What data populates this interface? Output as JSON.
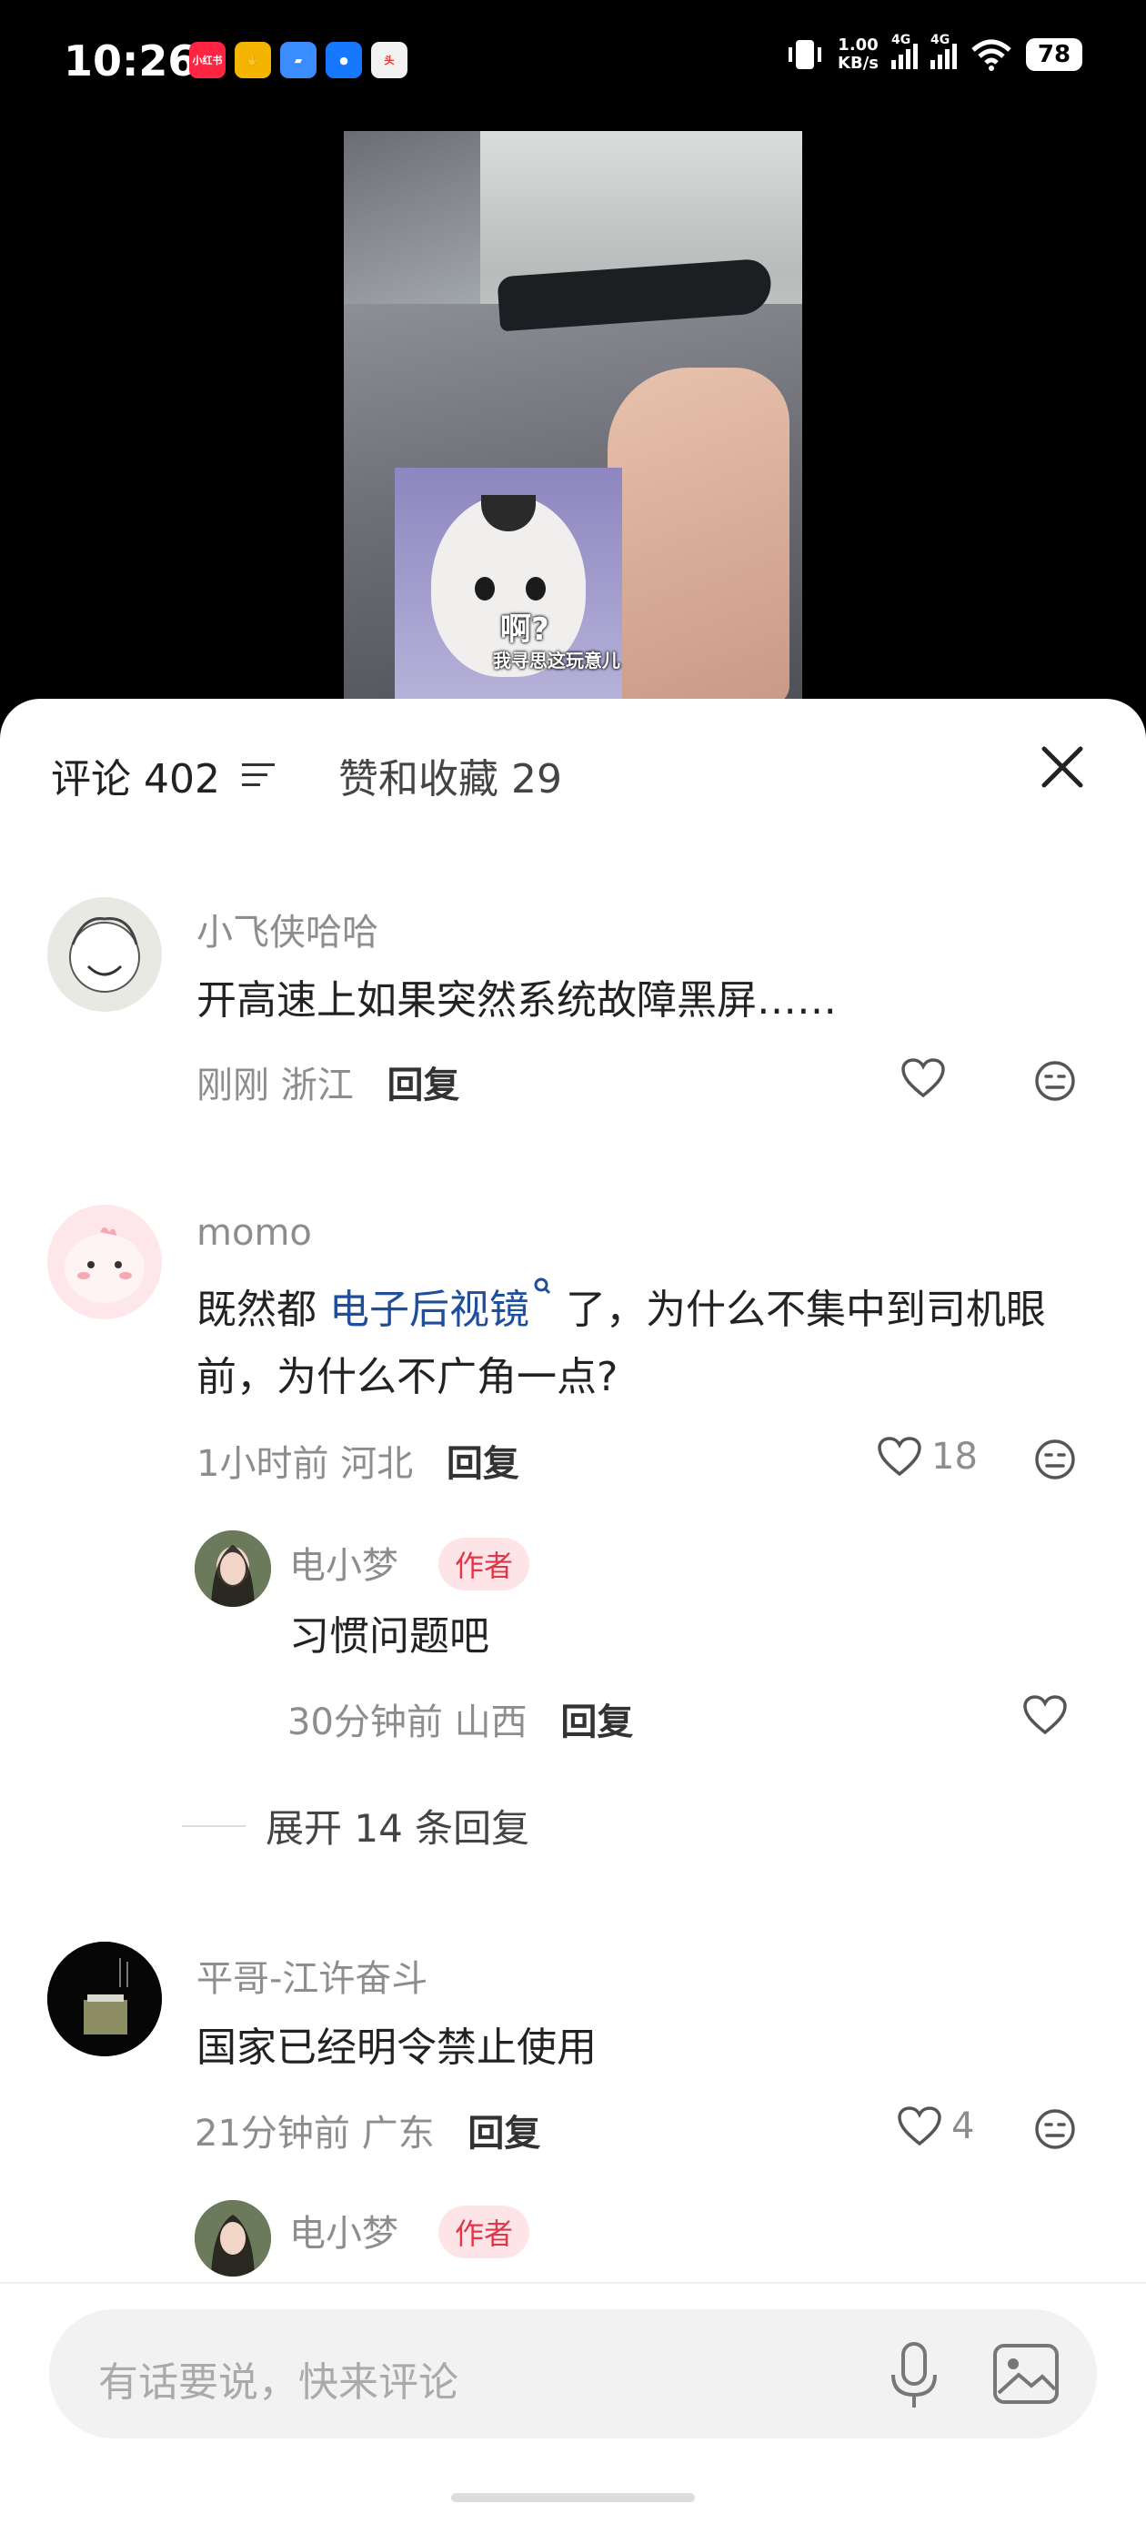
{
  "status_bar": {
    "time": "10:26",
    "network_speed_value": "1.00",
    "network_speed_unit": "KB/s",
    "signal_1_label": "4G",
    "signal_2_label": "4G",
    "battery": "78",
    "notification_icons": [
      "xiaohongshu-icon",
      "hand-app-icon",
      "files-app-icon",
      "message-app-icon",
      "toutiao-app-icon"
    ]
  },
  "video": {
    "subtitle_main": "啊?",
    "subtitle_sub": "我寻思这玩意儿"
  },
  "sheet": {
    "tab_comments": "评论 402",
    "tab_likes": "赞和收藏 29"
  },
  "comments": [
    {
      "username": "小飞侠哈哈",
      "text": "开高速上如果突然系统故障黑屏……",
      "time": "刚刚",
      "location": "浙江",
      "reply_label": "回复",
      "likes": ""
    },
    {
      "username": "momo",
      "text_before": "既然都 ",
      "text_link": "电子后视镜",
      "text_after": " 了，为什么不集中到司机眼前，为什么不广角一点?",
      "time": "1小时前",
      "location": "河北",
      "reply_label": "回复",
      "likes": "18",
      "reply": {
        "username": "电小梦",
        "tag": "作者",
        "text": "习惯问题吧",
        "time": "30分钟前",
        "location": "山西",
        "reply_label": "回复"
      },
      "expand_label": "展开 14 条回复"
    },
    {
      "username": "平哥-江许奋斗",
      "text": "国家已经明令禁止使用",
      "time": "21分钟前",
      "location": "广东",
      "reply_label": "回复",
      "likes": "4",
      "reply": {
        "username": "电小梦",
        "tag": "作者"
      }
    }
  ],
  "input": {
    "placeholder": "有话要说，快来评论"
  },
  "colors": {
    "link": "#1f4f9a",
    "author_tag_bg": "#fde4e7",
    "author_tag_text": "#e1364a"
  }
}
